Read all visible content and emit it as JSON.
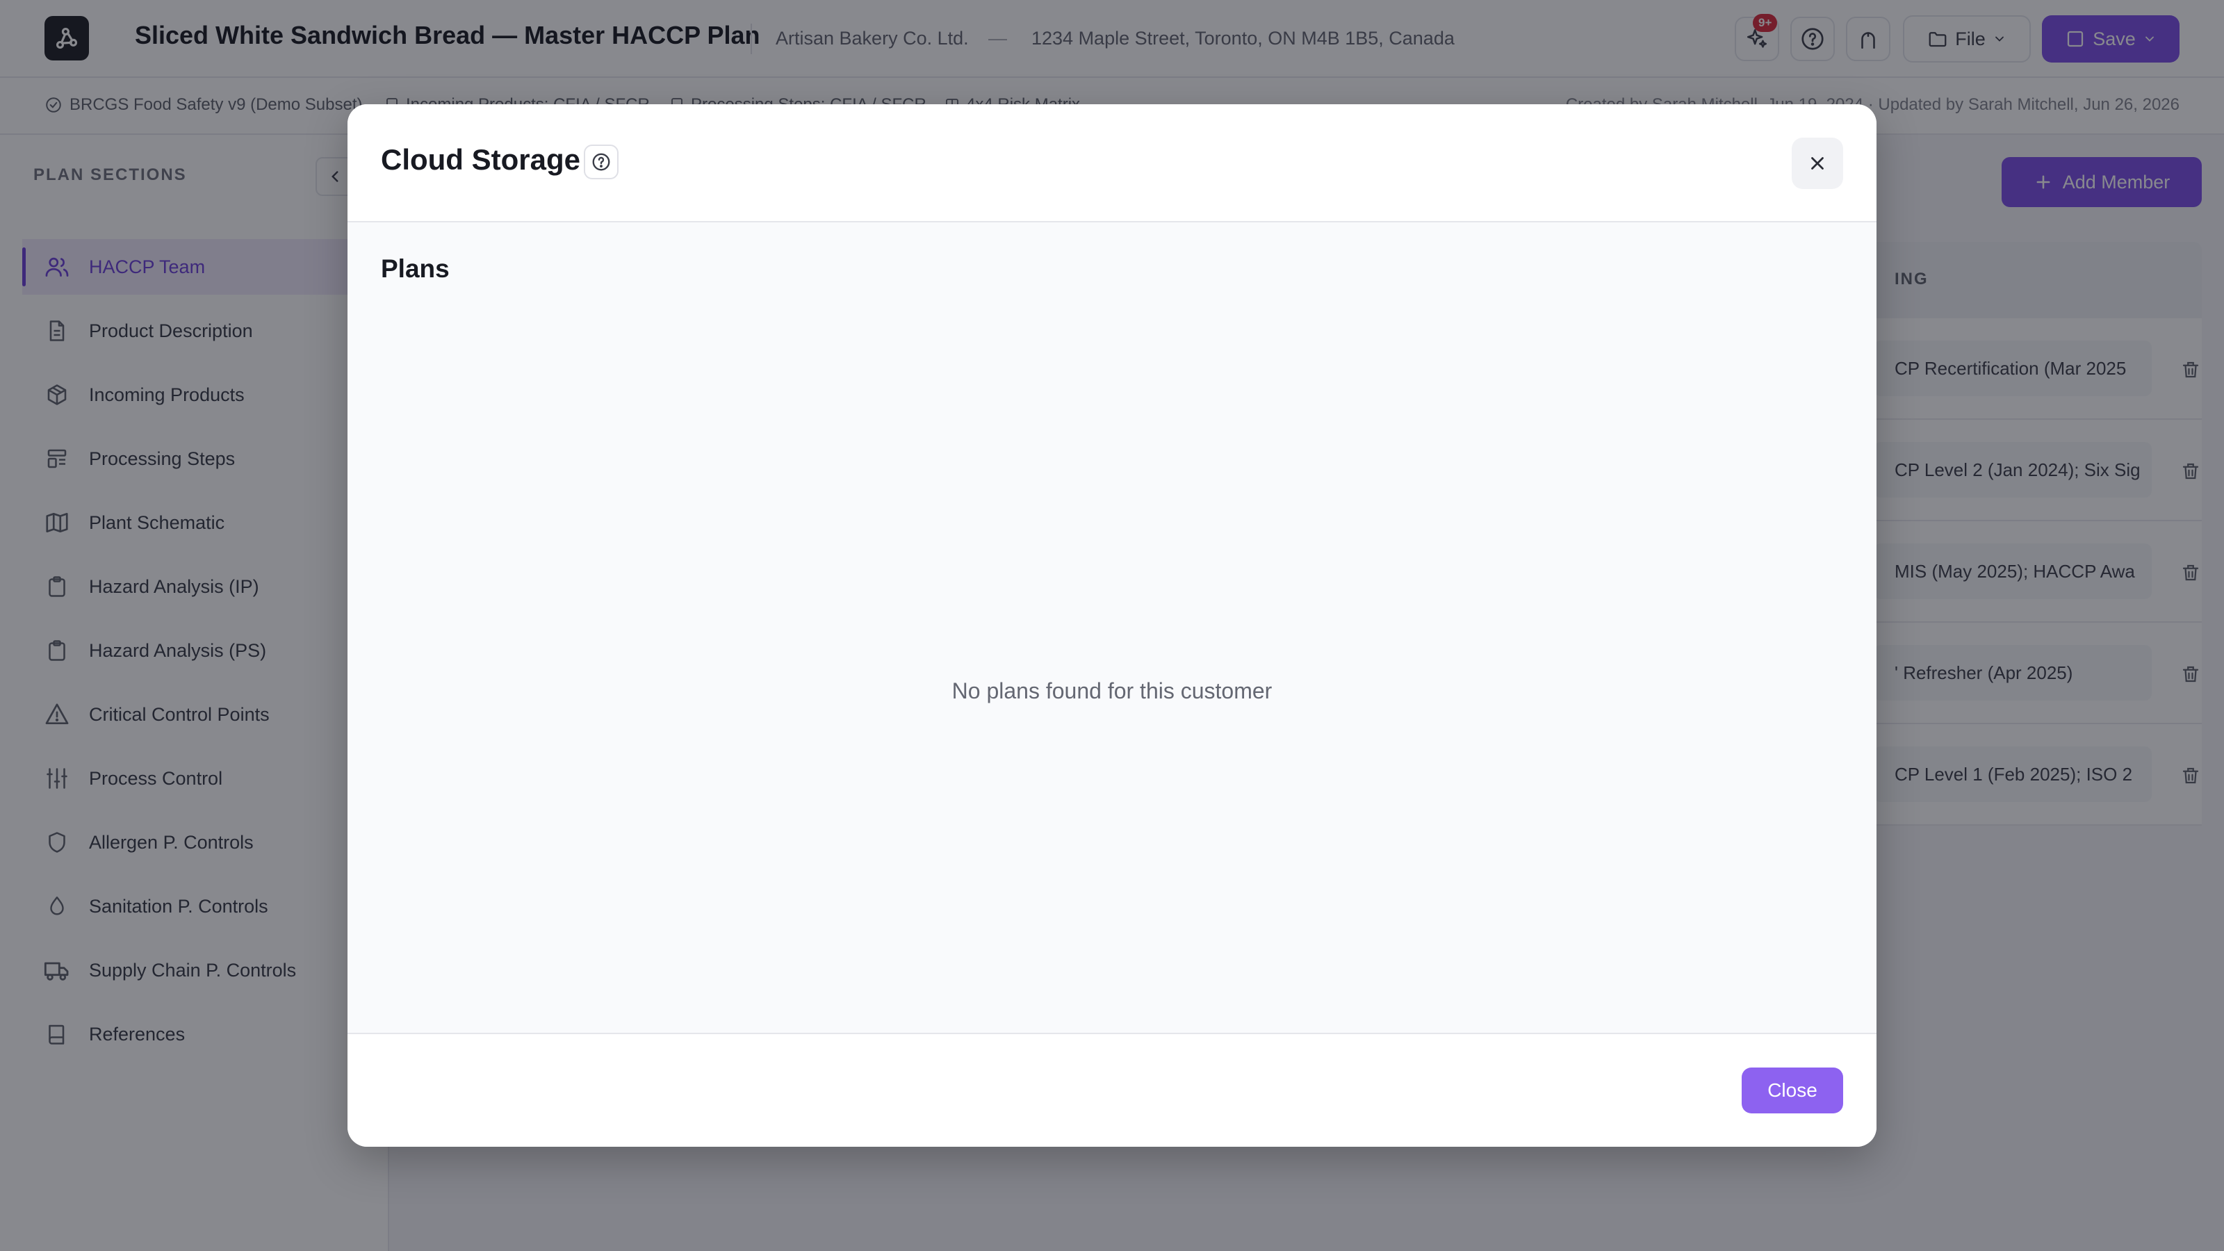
{
  "header": {
    "title": "Sliced White Sandwich Bread — Master HACCP Plan",
    "company": "Artisan Bakery Co. Ltd.",
    "separator": "—",
    "address": "1234 Maple Street, Toronto, ON M4B 1B5, Canada",
    "notification_badge": "9+",
    "file_label": "File",
    "save_label": "Save",
    "accent_color": "#7a4ce6"
  },
  "subbar": {
    "standard": "BRCGS Food Safety v9 (Demo Subset)",
    "chips": [
      "Incoming Products: CFIA / SFCR",
      "Processing Steps: CFIA / SFCR",
      "4x4 Risk Matrix"
    ],
    "meta": "Created by Sarah Mitchell, Jun 19, 2024 · Updated by Sarah Mitchell, Jun 26, 2026"
  },
  "sidebar": {
    "title": "PLAN SECTIONS",
    "items": [
      {
        "label": "HACCP Team",
        "icon": "users-icon",
        "active": true
      },
      {
        "label": "Product Description",
        "icon": "document-icon"
      },
      {
        "label": "Incoming Products",
        "icon": "package-icon"
      },
      {
        "label": "Processing Steps",
        "icon": "layout-icon"
      },
      {
        "label": "Plant Schematic",
        "icon": "map-icon"
      },
      {
        "label": "Hazard Analysis (IP)",
        "icon": "clipboard-icon"
      },
      {
        "label": "Hazard Analysis (PS)",
        "icon": "clipboard-icon"
      },
      {
        "label": "Critical Control Points",
        "icon": "warning-icon"
      },
      {
        "label": "Process Control",
        "icon": "sliders-icon"
      },
      {
        "label": "Allergen P. Controls",
        "icon": "shield-icon"
      },
      {
        "label": "Sanitation P. Controls",
        "icon": "droplet-icon"
      },
      {
        "label": "Supply Chain P. Controls",
        "icon": "truck-icon"
      },
      {
        "label": "References",
        "icon": "book-icon"
      }
    ]
  },
  "main": {
    "add_member_label": "Add Member",
    "training_header": "ING",
    "training_rows": [
      "CP Recertification (Mar 2025",
      "CP Level 2 (Jan 2024); Six Sig",
      "MIS (May 2025); HACCP Awa",
      "' Refresher (Apr 2025)",
      "CP Level 1 (Feb 2025); ISO 2"
    ]
  },
  "modal": {
    "title": "Cloud Storage",
    "section_title": "Plans",
    "empty_message": "No plans found for this customer",
    "close_label": "Close"
  }
}
